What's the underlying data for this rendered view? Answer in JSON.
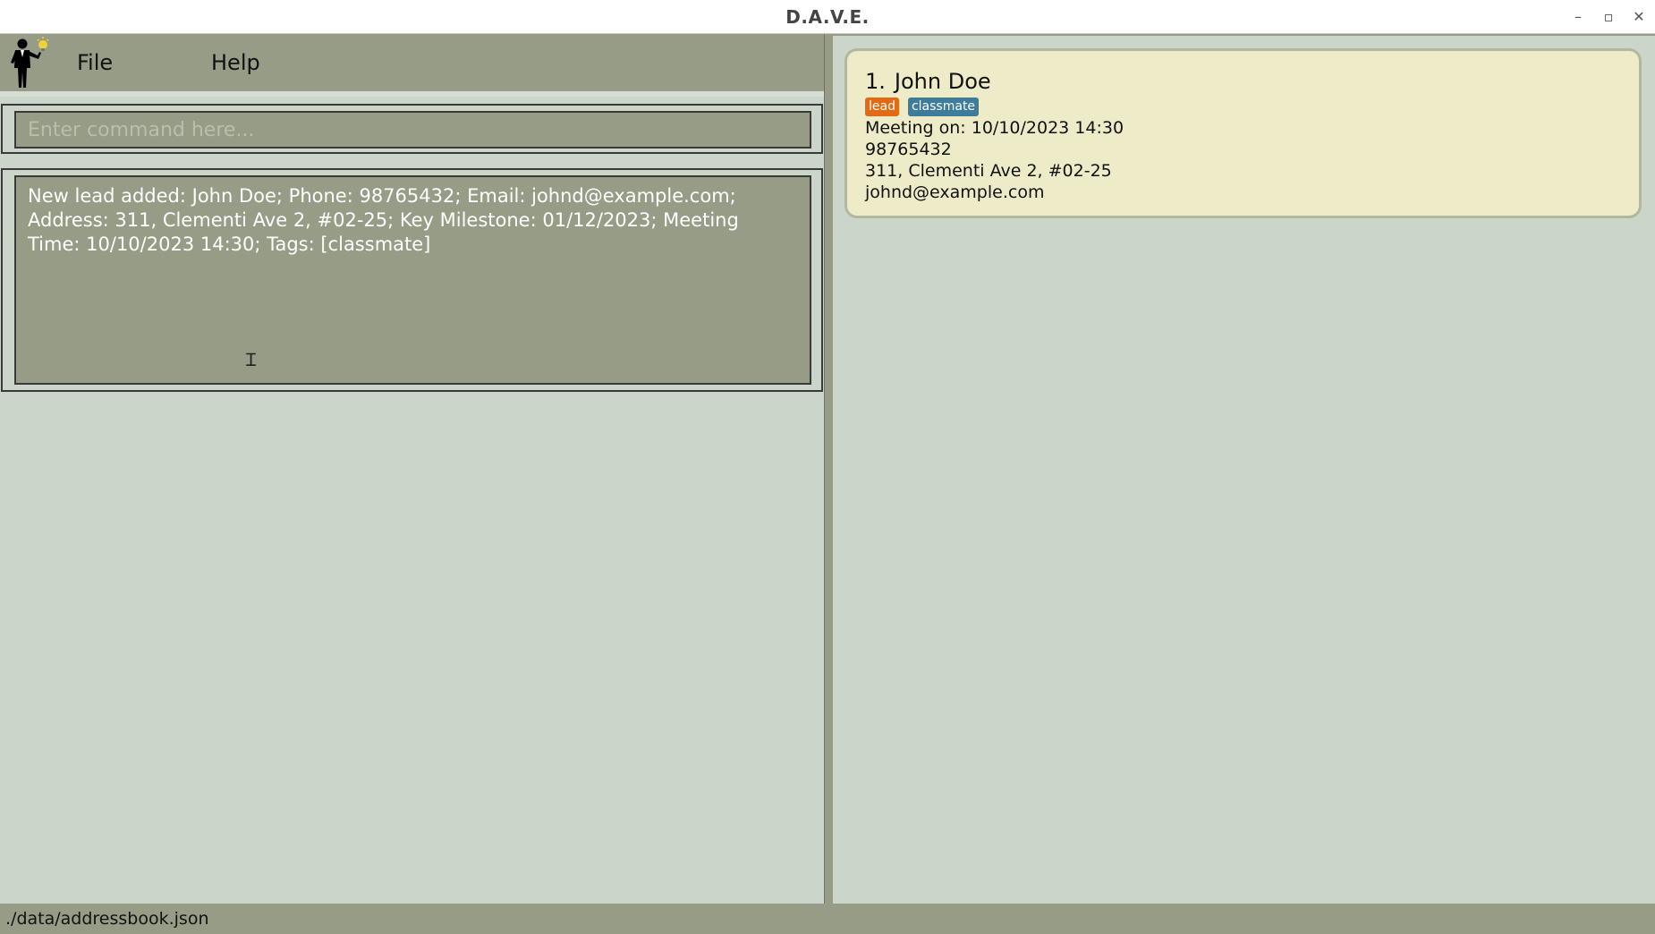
{
  "window": {
    "title": "D.A.V.E.",
    "controls": {
      "minimize": "–",
      "maximize": "▫",
      "close": "✕"
    }
  },
  "menu": {
    "logo_icon": "businessman-lightbulb-icon",
    "items": [
      {
        "label": "File"
      },
      {
        "label": "Help"
      }
    ]
  },
  "command": {
    "placeholder": "Enter command here...",
    "value": ""
  },
  "result": {
    "text": "New lead added: John Doe; Phone: 98765432; Email: johnd@example.com;\nAddress: 311, Clementi Ave 2, #02-25; Key Milestone: 01/12/2023; Meeting\nTime: 10/10/2023 14:30; Tags: [classmate]"
  },
  "persons": [
    {
      "index": "1.",
      "name": "John Doe",
      "tags": [
        "lead",
        "classmate"
      ],
      "meeting": "Meeting on: 10/10/2023 14:30",
      "phone": "98765432",
      "address": "311, Clementi Ave 2, #02-25",
      "email": "johnd@example.com"
    }
  ],
  "status": {
    "file_path": "./data/addressbook.json"
  },
  "colors": {
    "background": "#cbd5ca",
    "panel": "#969c86",
    "card": "#edebc8",
    "tag_lead": "#e36a12",
    "tag_classmate": "#3d7c9b"
  }
}
